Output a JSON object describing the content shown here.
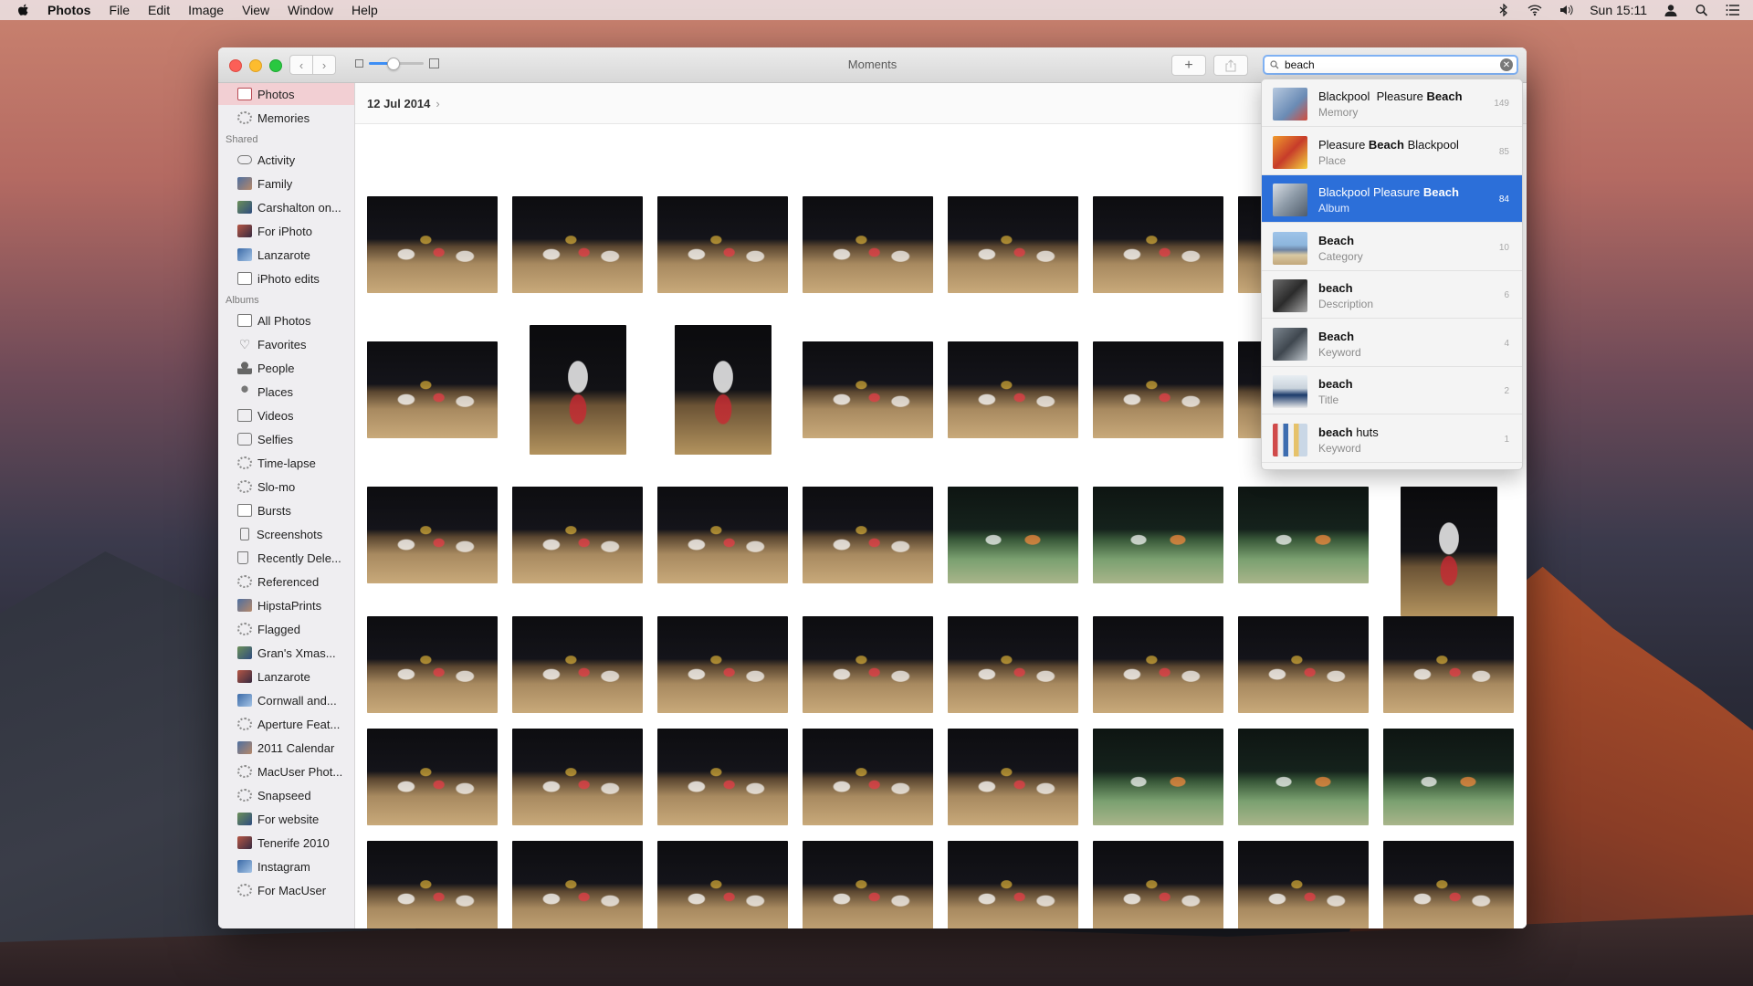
{
  "menubar": {
    "app_name": "Photos",
    "menus": [
      "File",
      "Edit",
      "Image",
      "View",
      "Window",
      "Help"
    ],
    "clock": "Sun 15:11",
    "status_icons": [
      "bluetooth-icon",
      "wifi-icon",
      "volume-icon",
      "user-icon",
      "spotlight-icon",
      "notification-center-icon"
    ]
  },
  "window": {
    "title": "Moments",
    "search": {
      "value": "beach",
      "placeholder": "Search"
    },
    "add_label": "+"
  },
  "sidebar": {
    "library": [
      {
        "label": "Photos",
        "icon": "photos-icon",
        "selected": true
      },
      {
        "label": "Memories",
        "icon": "memories-icon"
      }
    ],
    "shared_header": "Shared",
    "shared": [
      {
        "label": "Activity",
        "icon": "cloud-icon"
      },
      {
        "label": "Family",
        "icon": "album-thumb-icon"
      },
      {
        "label": "Carshalton on...",
        "icon": "album-thumb-icon"
      },
      {
        "label": "For iPhoto",
        "icon": "album-thumb-icon"
      },
      {
        "label": "Lanzarote",
        "icon": "album-thumb-icon"
      },
      {
        "label": "iPhoto edits",
        "icon": "album-icon"
      }
    ],
    "albums_header": "Albums",
    "albums": [
      {
        "label": "All Photos",
        "icon": "album-icon"
      },
      {
        "label": "Favorites",
        "icon": "heart-icon"
      },
      {
        "label": "People",
        "icon": "person-icon"
      },
      {
        "label": "Places",
        "icon": "pin-icon"
      },
      {
        "label": "Videos",
        "icon": "video-icon"
      },
      {
        "label": "Selfies",
        "icon": "camera-icon"
      },
      {
        "label": "Time-lapse",
        "icon": "gear-icon"
      },
      {
        "label": "Slo-mo",
        "icon": "gear-icon"
      },
      {
        "label": "Bursts",
        "icon": "album-icon"
      },
      {
        "label": "Screenshots",
        "icon": "phone-icon"
      },
      {
        "label": "Recently Dele...",
        "icon": "trash-icon"
      },
      {
        "label": "Referenced",
        "icon": "gear-icon"
      },
      {
        "label": "HipstaPrints",
        "icon": "album-thumb-icon"
      },
      {
        "label": "Flagged",
        "icon": "gear-icon"
      },
      {
        "label": "Gran's Xmas...",
        "icon": "album-thumb-icon"
      },
      {
        "label": "Lanzarote",
        "icon": "album-thumb-icon"
      },
      {
        "label": "Cornwall and...",
        "icon": "album-thumb-icon"
      },
      {
        "label": "Aperture Feat...",
        "icon": "gear-icon"
      },
      {
        "label": "2011 Calendar",
        "icon": "album-thumb-icon"
      },
      {
        "label": "MacUser Phot...",
        "icon": "gear-icon"
      },
      {
        "label": "Snapseed",
        "icon": "gear-icon"
      },
      {
        "label": "For website",
        "icon": "album-thumb-icon"
      },
      {
        "label": "Tenerife 2010",
        "icon": "album-thumb-icon"
      },
      {
        "label": "Instagram",
        "icon": "album-thumb-icon"
      },
      {
        "label": "For MacUser",
        "icon": "gear-icon"
      }
    ]
  },
  "moment": {
    "date": "12 Jul 2014"
  },
  "search_results": [
    {
      "pre": "Blackpool  Pleasure ",
      "match": "Beach",
      "post": "",
      "type": "Memory",
      "count": "149"
    },
    {
      "pre": "Pleasure ",
      "match": "Beach",
      "post": " Blackpool",
      "type": "Place",
      "count": "85"
    },
    {
      "pre": "Blackpool Pleasure ",
      "match": "Beach",
      "post": "",
      "type": "Album",
      "count": "84",
      "selected": true
    },
    {
      "pre": "",
      "match": "Beach",
      "post": "",
      "type": "Category",
      "count": "10"
    },
    {
      "pre": "",
      "match": "beach",
      "post": "",
      "type": "Description",
      "count": "6"
    },
    {
      "pre": "",
      "match": "Beach",
      "post": "",
      "type": "Keyword",
      "count": "4"
    },
    {
      "pre": "",
      "match": "beach",
      "post": "",
      "type": "Title",
      "count": "2"
    },
    {
      "pre": "",
      "match": "beach",
      "post": " huts",
      "type": "Keyword",
      "count": "1"
    }
  ]
}
